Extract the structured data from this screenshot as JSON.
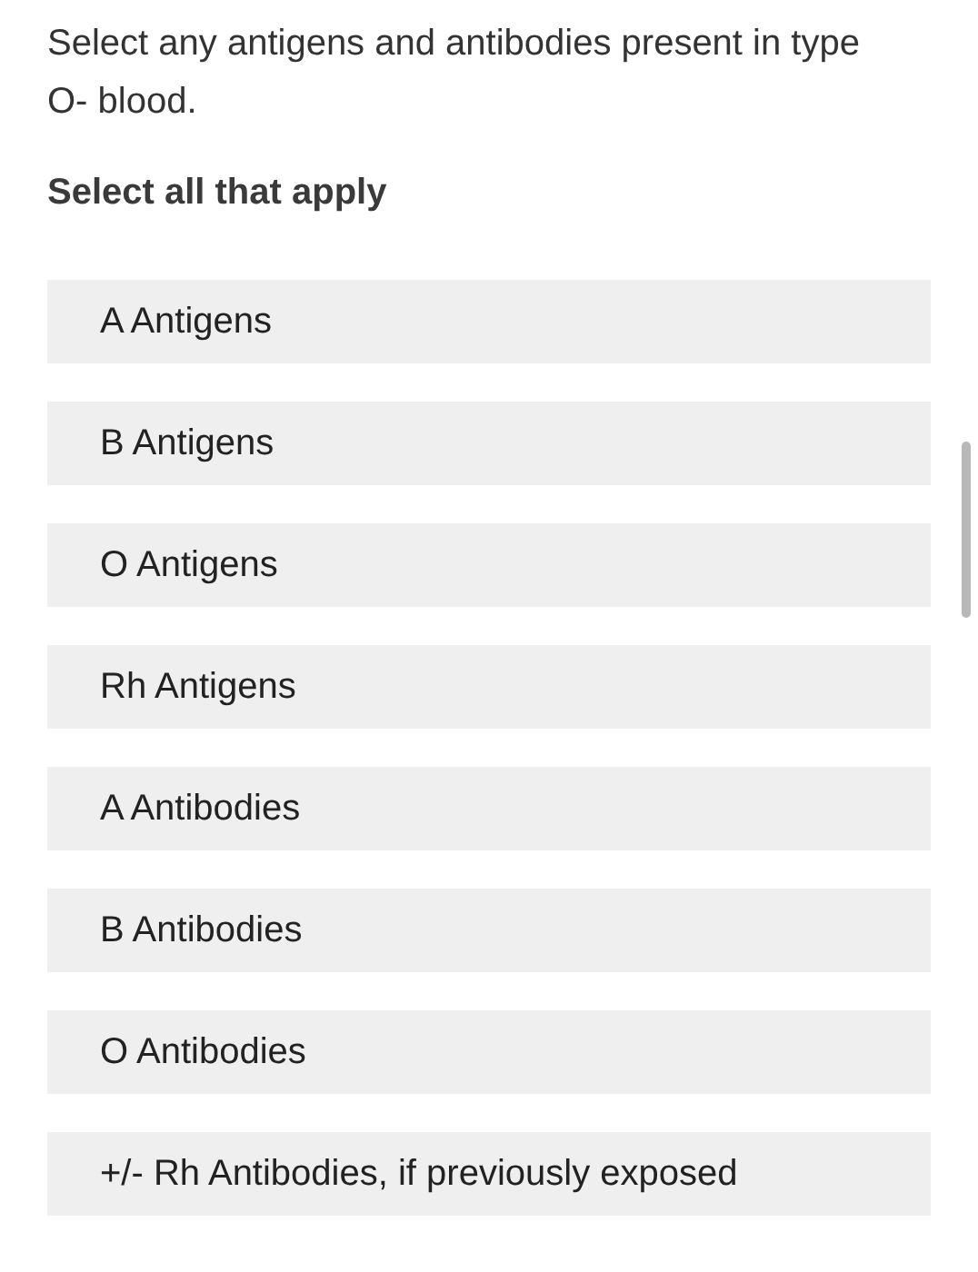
{
  "question": "Select any antigens and antibodies present in type O- blood.",
  "instruction": "Select all that apply",
  "options": [
    {
      "label": "A Antigens",
      "selected": false
    },
    {
      "label": "B Antigens",
      "selected": false
    },
    {
      "label": "O Antigens",
      "selected": false
    },
    {
      "label": "Rh Antigens",
      "selected": false
    },
    {
      "label": "A Antibodies",
      "selected": false
    },
    {
      "label": "B Antibodies",
      "selected": false
    },
    {
      "label": "O Antibodies",
      "selected": false
    },
    {
      "label": "+/- Rh Antibodies, if previously exposed",
      "selected": false
    }
  ]
}
